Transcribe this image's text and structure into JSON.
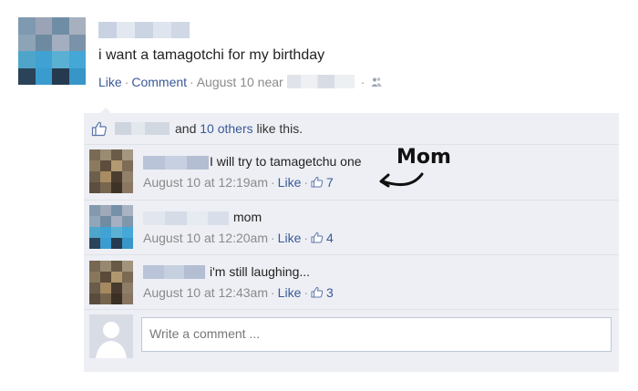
{
  "post": {
    "text": "i want a tamagotchi for my birthday",
    "meta": {
      "like": "Like",
      "comment": "Comment",
      "date": "August 10 near",
      "sep": "·"
    }
  },
  "likes": {
    "text_and": "and",
    "others_link": "10 others",
    "text_tail": "like this."
  },
  "comments": [
    {
      "text": "I will try to tamagetchu one",
      "time": "August 10 at 12:19am",
      "like": "Like",
      "likes": "7"
    },
    {
      "text": "mom",
      "time": "August 10 at 12:20am",
      "like": "Like",
      "likes": "4"
    },
    {
      "text": "i'm still laughing...",
      "time": "August 10 at 12:43am",
      "like": "Like",
      "likes": "3"
    }
  ],
  "annotation": {
    "label": "Mom"
  },
  "write_comment": {
    "placeholder": "Write a comment ..."
  },
  "icons": {
    "thumb": "thumbs-up-icon",
    "people": "people-icon",
    "arrow": "curved-arrow-icon",
    "avatar_placeholder": "default-avatar-icon"
  },
  "colors": {
    "link": "#3b5998",
    "comment_bg": "#edeff4",
    "meta_gray": "#8a8a8a",
    "input_border": "#bdc7d8"
  }
}
